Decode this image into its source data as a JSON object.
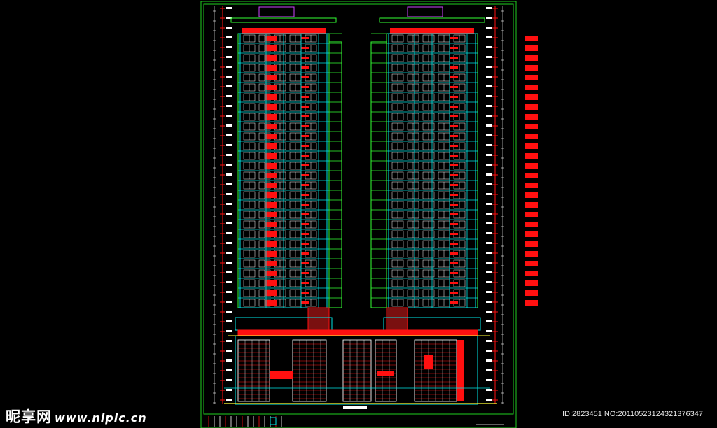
{
  "watermark": {
    "logo": "昵享网",
    "site": "www.nipic.cn"
  },
  "image_meta": "ID:2823451 NO:20110523124321376347",
  "drawing": {
    "background": "#000000",
    "colors": {
      "frame": "#1fd01f",
      "red": "#ff1010",
      "cyan": "#00e6e6",
      "green": "#33ff33",
      "yellow": "#ffff33",
      "magenta": "#cc44ff",
      "white": "#ffffff"
    }
  }
}
